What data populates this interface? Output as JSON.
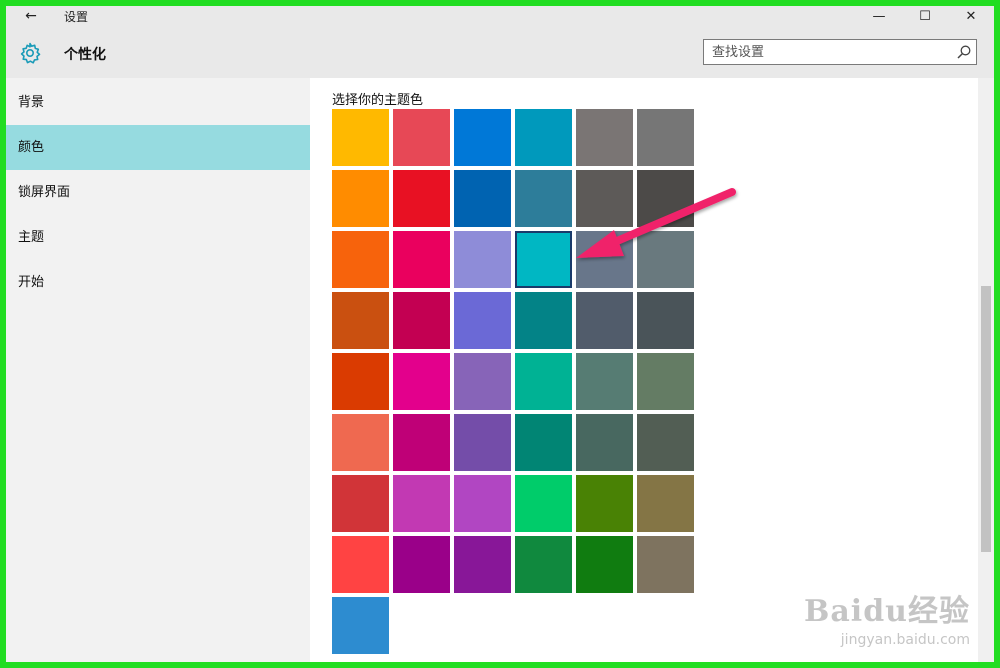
{
  "window": {
    "title": "设置",
    "minimize": "—",
    "maximize": "☐",
    "close": "✕",
    "back": "←"
  },
  "header": {
    "title": "个性化",
    "search_placeholder": "查找设置",
    "icon": "gear-icon"
  },
  "sidebar": {
    "items": [
      {
        "label": "背景",
        "selected": false
      },
      {
        "label": "颜色",
        "selected": true
      },
      {
        "label": "锁屏界面",
        "selected": false
      },
      {
        "label": "主题",
        "selected": false
      },
      {
        "label": "开始",
        "selected": false
      }
    ]
  },
  "main": {
    "section_title": "选择你的主题色",
    "selected_color": "#00B7C3",
    "colors": [
      "#FFB900",
      "#E74856",
      "#0078D7",
      "#0099BC",
      "#7A7574",
      "#767676",
      "#FF8C00",
      "#E81123",
      "#0063B1",
      "#2D7D9A",
      "#5D5A58",
      "#4C4A48",
      "#F7630C",
      "#EA005E",
      "#8E8CD8",
      "#00B7C3",
      "#68768A",
      "#69797E",
      "#CA5010",
      "#C30052",
      "#6B69D6",
      "#038387",
      "#515C6B",
      "#4A5459",
      "#DA3B01",
      "#E3008C",
      "#8764B8",
      "#00B294",
      "#567C73",
      "#647C64",
      "#EF6950",
      "#BF0077",
      "#744DA9",
      "#018574",
      "#486860",
      "#525E54",
      "#D13438",
      "#C239B3",
      "#B146C2",
      "#00CC6A",
      "#498205",
      "#847545",
      "#FF4343",
      "#9A0089",
      "#881798",
      "#10893E",
      "#107C10",
      "#7E735F",
      "#2D8CD0"
    ]
  },
  "overlay": {
    "arrow_color": "#F0246A"
  },
  "watermark": {
    "brand": "Baidu经验",
    "url": "jingyan.baidu.com"
  }
}
